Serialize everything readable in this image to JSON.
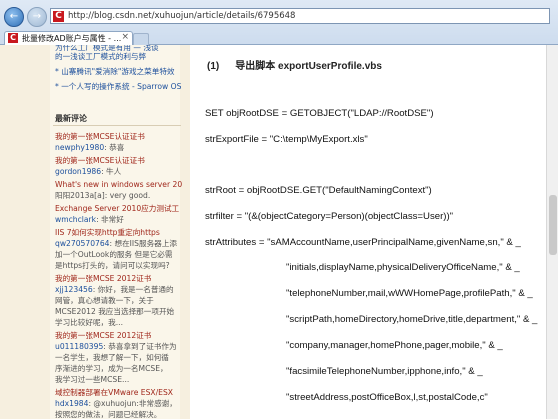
{
  "browser": {
    "url": "http://blog.csdn.net/xuhuojun/article/details/6795648",
    "tab_title": "批量修改AD账户与属性 - ...",
    "tab_close": "×",
    "back_glyph": "←",
    "forward_glyph": "→",
    "favicon_letter": "C"
  },
  "sidebar": {
    "top_links": [
      "的一浅谈工厂模式的利与弊",
      "* 山寨腾讯\"爱消除\"游戏之菜单特效",
      "* 一个人写的操作系统 - Sparrow OS"
    ],
    "cut_off_top": "为什么工厂模式是有用 — 浅谈",
    "recent_comments_title": "最新评论",
    "comments": [
      {
        "title": "我的第一张MCSE认证证书",
        "user": "newphy1980",
        "text": ": 恭喜"
      },
      {
        "title": "我的第一张MCSE认证证书",
        "user": "gordon1986",
        "text": ": 牛人"
      },
      {
        "title": "What's new in windows server 201",
        "user": "",
        "text": "阳阳2013a[a]: very good."
      },
      {
        "title": "Exchange Server 2010应力测试工",
        "user": "wmchclark",
        "text": ": 非常好"
      },
      {
        "title": "IIS 7如何实现http重定向https",
        "user": "qw270570764",
        "text": ": 想在IIS服务器上添",
        "extra": [
          "加一个OutLook的服务 但是它必需",
          "是https打头的，请问可以实现吗?"
        ]
      },
      {
        "title": "我的第一张MCSE 2012证书",
        "user": "xjj123456",
        "text": ": 你好，我是一名普通的",
        "extra": [
          "网管，真心想请教一下，关于",
          "MCSE2012 我应当选择那一项开始",
          "学习比较好呢，我..."
        ]
      },
      {
        "title": "我的第一张MCSE 2012证书",
        "user": "u011180395",
        "text": ": 恭喜拿到了证书作为",
        "extra": [
          "一名学生，我想了解一下，如何循",
          "序渐进的学习，成为一名MCSE，",
          "我学习过一些MCSE..."
        ]
      },
      {
        "title": "域控制器部署在VMware ESX/ESX",
        "user": "hdx1984",
        "text": ": @xuhuojun:非常感谢，",
        "extra": [
          "按照您的做法，问题已经解决。"
        ]
      }
    ]
  },
  "article": {
    "heading_number": "(1)",
    "heading_text": "导出脚本 exportUserProfile.vbs",
    "code_lines": [
      "SET objRootDSE = GETOBJECT(\"LDAP://RootDSE\")",
      "strExportFile = \"C:\\temp\\MyExport.xls\"",
      "strRoot = objRootDSE.GET(\"DefaultNamingContext\")",
      "strfilter = \"(&(objectCategory=Person)(objectClass=User))\"",
      "strAttributes = \"sAMAccountName,userPrincipalName,givenName,sn,\" & _",
      "\"initials,displayName,physicalDeliveryOfficeName,\" & _",
      "\"telephoneNumber,mail,wWWHomePage,profilePath,\" & _",
      "\"scriptPath,homeDirectory,homeDrive,title,department,\" & _",
      "\"company,manager,homePhone,pager,mobile,\" & _",
      "\"facsimileTelephoneNumber,ipphone,info,\" & _",
      "\"streetAddress,postOfficeBox,l,st,postalCode,c\""
    ]
  }
}
